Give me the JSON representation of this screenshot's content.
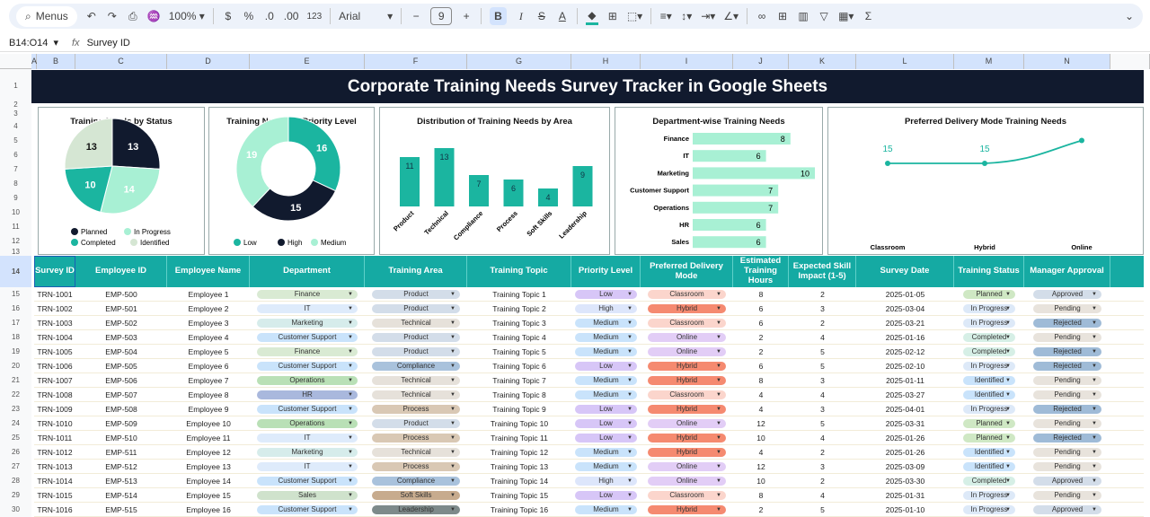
{
  "toolbar": {
    "search": "Menus",
    "zoom": "100%",
    "currency": "$",
    "percent": "%",
    "dec_less": ".0",
    "dec_more": ".00",
    "number_format": "123",
    "font": "Arial",
    "font_size": "9",
    "minus": "−",
    "plus": "+",
    "bold": "B",
    "italic": "I",
    "strike": "S",
    "text_color": "A",
    "sum": "Σ"
  },
  "formula": {
    "name_box": "B14:O14",
    "fx": "fx",
    "content": "Survey ID"
  },
  "columns": [
    "A",
    "B",
    "C",
    "D",
    "E",
    "F",
    "G",
    "H",
    "I",
    "J",
    "K",
    "L",
    "M",
    "N"
  ],
  "row_numbers": [
    "1",
    "2",
    "3",
    "4",
    "5",
    "6",
    "7",
    "8",
    "9",
    "10",
    "11",
    "12",
    "13",
    "14",
    "15",
    "16",
    "17",
    "18",
    "19",
    "20",
    "21",
    "22",
    "23",
    "24",
    "25",
    "26",
    "27",
    "28",
    "29",
    "30"
  ],
  "title": "Corporate Training Needs Survey Tracker in Google Sheets",
  "chart_data": [
    {
      "type": "pie",
      "title": "Training Needs by Status",
      "categories": [
        "Planned",
        "In Progress",
        "Completed",
        "Identified"
      ],
      "values": [
        13,
        14,
        10,
        13
      ],
      "colors": [
        "#111a2e",
        "#a8f0d4",
        "#1bb5a0",
        "#d5e6d3"
      ],
      "legend": "bottom"
    },
    {
      "type": "pie",
      "title": "Training Needs by Priority Level",
      "categories": [
        "Low",
        "High",
        "Medium"
      ],
      "values": [
        16,
        15,
        19
      ],
      "colors": [
        "#1bb5a0",
        "#111a2e",
        "#a8f0d4"
      ],
      "legend": "bottom",
      "donut": true
    },
    {
      "type": "bar",
      "title": "Distribution of Training Needs by Area",
      "categories": [
        "Product",
        "Technical",
        "Compliance",
        "Process",
        "Soft Skills",
        "Leadership"
      ],
      "values": [
        11,
        13,
        7,
        6,
        4,
        9
      ],
      "color": "#1bb5a0"
    },
    {
      "type": "bar",
      "orientation": "horizontal",
      "title": "Department-wise Training Needs",
      "categories": [
        "Finance",
        "IT",
        "Marketing",
        "Customer Support",
        "Operations",
        "HR",
        "Sales"
      ],
      "values": [
        8,
        6,
        10,
        7,
        7,
        6,
        6
      ],
      "color": "#a8f0d4"
    },
    {
      "type": "line",
      "title": "Preferred Delivery Mode Training Needs",
      "categories": [
        "Classroom",
        "Hybrid",
        "Online"
      ],
      "values": [
        15,
        15,
        18
      ],
      "labels": [
        "15",
        "15"
      ],
      "color": "#1bb5a0"
    }
  ],
  "table": {
    "headers": [
      "Survey ID",
      "Employee ID",
      "Employee Name",
      "Department",
      "Training Area",
      "Training Topic",
      "Priority Level",
      "Preferred Delivery Mode",
      "Estimated Training Hours",
      "Expected Skill Impact (1-5)",
      "Survey Date",
      "Training Status",
      "Manager Approval"
    ],
    "rows": [
      [
        "TRN-1001",
        "EMP-500",
        "Employee 1",
        "Finance",
        "Product",
        "Training Topic 1",
        "Low",
        "Classroom",
        "8",
        "2",
        "2025-01-05",
        "Planned",
        "Approved"
      ],
      [
        "TRN-1002",
        "EMP-501",
        "Employee 2",
        "IT",
        "Product",
        "Training Topic 2",
        "High",
        "Hybrid",
        "6",
        "3",
        "2025-03-04",
        "In Progress",
        "Pending"
      ],
      [
        "TRN-1003",
        "EMP-502",
        "Employee 3",
        "Marketing",
        "Technical",
        "Training Topic 3",
        "Medium",
        "Classroom",
        "6",
        "2",
        "2025-03-21",
        "In Progress",
        "Rejected"
      ],
      [
        "TRN-1004",
        "EMP-503",
        "Employee 4",
        "Customer Support",
        "Product",
        "Training Topic 4",
        "Medium",
        "Online",
        "2",
        "4",
        "2025-01-16",
        "Completed",
        "Pending"
      ],
      [
        "TRN-1005",
        "EMP-504",
        "Employee 5",
        "Finance",
        "Product",
        "Training Topic 5",
        "Medium",
        "Online",
        "2",
        "5",
        "2025-02-12",
        "Completed",
        "Rejected"
      ],
      [
        "TRN-1006",
        "EMP-505",
        "Employee 6",
        "Customer Support",
        "Compliance",
        "Training Topic 6",
        "Low",
        "Hybrid",
        "6",
        "5",
        "2025-02-10",
        "In Progress",
        "Rejected"
      ],
      [
        "TRN-1007",
        "EMP-506",
        "Employee 7",
        "Operations",
        "Technical",
        "Training Topic 7",
        "Medium",
        "Hybrid",
        "8",
        "3",
        "2025-01-11",
        "Identified",
        "Pending"
      ],
      [
        "TRN-1008",
        "EMP-507",
        "Employee 8",
        "HR",
        "Technical",
        "Training Topic 8",
        "Medium",
        "Classroom",
        "4",
        "4",
        "2025-03-27",
        "Identified",
        "Pending"
      ],
      [
        "TRN-1009",
        "EMP-508",
        "Employee 9",
        "Customer Support",
        "Process",
        "Training Topic 9",
        "Low",
        "Hybrid",
        "4",
        "3",
        "2025-04-01",
        "In Progress",
        "Rejected"
      ],
      [
        "TRN-1010",
        "EMP-509",
        "Employee 10",
        "Operations",
        "Product",
        "Training Topic 10",
        "Low",
        "Online",
        "12",
        "5",
        "2025-03-31",
        "Planned",
        "Pending"
      ],
      [
        "TRN-1011",
        "EMP-510",
        "Employee 11",
        "IT",
        "Process",
        "Training Topic 11",
        "Low",
        "Hybrid",
        "10",
        "4",
        "2025-01-26",
        "Planned",
        "Rejected"
      ],
      [
        "TRN-1012",
        "EMP-511",
        "Employee 12",
        "Marketing",
        "Technical",
        "Training Topic 12",
        "Medium",
        "Hybrid",
        "4",
        "2",
        "2025-01-26",
        "Identified",
        "Pending"
      ],
      [
        "TRN-1013",
        "EMP-512",
        "Employee 13",
        "IT",
        "Process",
        "Training Topic 13",
        "Medium",
        "Online",
        "12",
        "3",
        "2025-03-09",
        "Identified",
        "Pending"
      ],
      [
        "TRN-1014",
        "EMP-513",
        "Employee 14",
        "Customer Support",
        "Compliance",
        "Training Topic 14",
        "High",
        "Online",
        "10",
        "2",
        "2025-03-30",
        "Completed",
        "Approved"
      ],
      [
        "TRN-1015",
        "EMP-514",
        "Employee 15",
        "Sales",
        "Soft Skills",
        "Training Topic 15",
        "Low",
        "Classroom",
        "8",
        "4",
        "2025-01-31",
        "In Progress",
        "Pending"
      ],
      [
        "TRN-1016",
        "EMP-515",
        "Employee 16",
        "Customer Support",
        "Leadership",
        "Training Topic 16",
        "Medium",
        "Hybrid",
        "2",
        "5",
        "2025-01-10",
        "In Progress",
        "Approved"
      ]
    ]
  },
  "chip_colors": {
    "Finance": "#d9ead3",
    "IT": "#deebfb",
    "Marketing": "#d6eceb",
    "Customer Support": "#c9e3fb",
    "Operations": "#b9e0b6",
    "HR": "#a9b8dd",
    "Sales": "#cfe2cc",
    "Product": "#d3dde9",
    "Technical": "#e6e1da",
    "Compliance": "#a9c2dc",
    "Process": "#d9c8b4",
    "Soft Skills": "#c7ab8e",
    "Leadership": "#7d8a8a",
    "Low": "#d7c6f7",
    "High": "#dde6fb",
    "Medium": "#c9e3fb",
    "Classroom": "#fbd5cc",
    "Hybrid": "#f58a70",
    "Online": "#e2cdf6",
    "Planned": "#cfe8c4",
    "In Progress": "#dde9f8",
    "Completed": "#d6efe6",
    "Identified": "#c9e3fb",
    "Approved": "#d3dde9",
    "Pending": "#e8e3dc",
    "Rejected": "#9fbbd7"
  }
}
